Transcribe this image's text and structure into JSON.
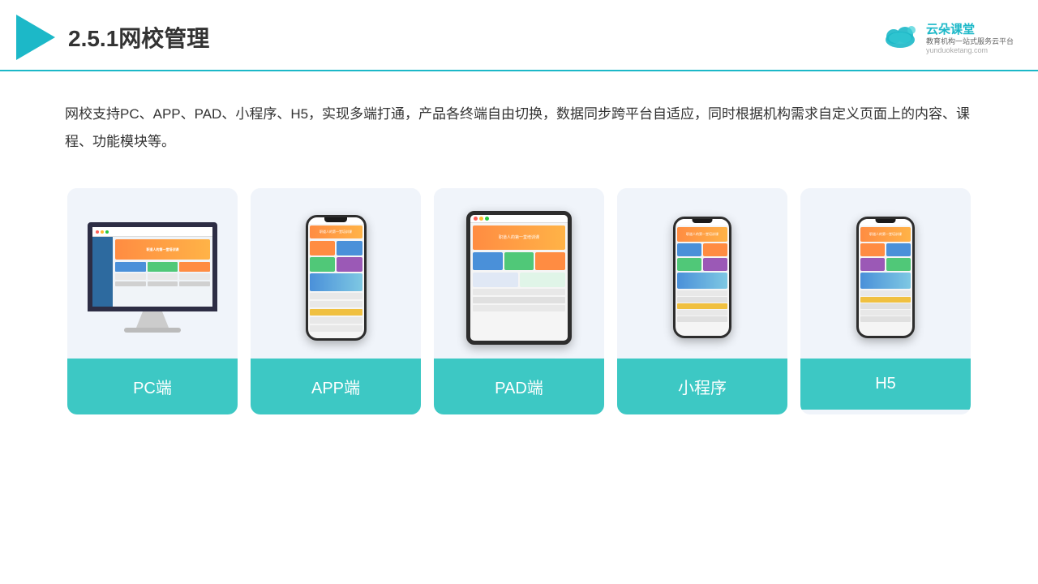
{
  "header": {
    "title": "2.5.1网校管理",
    "brand": {
      "name": "云朵课堂",
      "url": "yunduoketang.com",
      "tagline": "教育机构一站式服务云平台"
    }
  },
  "description": "网校支持PC、APP、PAD、小程序、H5，实现多端打通，产品各终端自由切换，数据同步跨平台自适应，同时根据机构需求自定义页面上的内容、课程、功能模块等。",
  "cards": [
    {
      "id": "pc",
      "label": "PC端"
    },
    {
      "id": "app",
      "label": "APP端"
    },
    {
      "id": "pad",
      "label": "PAD端"
    },
    {
      "id": "miniapp",
      "label": "小程序"
    },
    {
      "id": "h5",
      "label": "H5"
    }
  ]
}
